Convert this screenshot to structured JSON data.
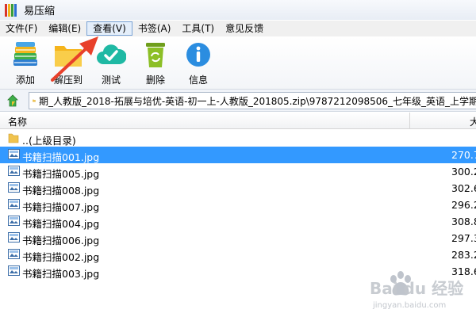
{
  "window": {
    "title": "易压缩"
  },
  "menu": {
    "items": [
      {
        "label": "文件(F)"
      },
      {
        "label": "编辑(E)"
      },
      {
        "label": "查看(V)"
      },
      {
        "label": "书签(A)"
      },
      {
        "label": "工具(T)"
      },
      {
        "label": "意见反馈"
      }
    ],
    "active_index": 2
  },
  "toolbar": {
    "add_label": "添加",
    "extract_label": "解压到",
    "test_label": "测试",
    "delete_label": "删除",
    "info_label": "信息"
  },
  "address": {
    "path": "期_人教版_2018-拓展与培优-英语-初一上-人教版_201805.zip\\9787212098506_七年级_英语_上学期_"
  },
  "list": {
    "columns": {
      "name": "名称",
      "size": "大"
    },
    "parent": {
      "name": "..(上级目录)"
    },
    "files": [
      {
        "name": "书籍扫描001.jpg",
        "size": "270.7",
        "selected": true
      },
      {
        "name": "书籍扫描005.jpg",
        "size": "300.2",
        "selected": false
      },
      {
        "name": "书籍扫描008.jpg",
        "size": "302.6",
        "selected": false
      },
      {
        "name": "书籍扫描007.jpg",
        "size": "296.2",
        "selected": false
      },
      {
        "name": "书籍扫描004.jpg",
        "size": "308.8",
        "selected": false
      },
      {
        "name": "书籍扫描006.jpg",
        "size": "297.3",
        "selected": false
      },
      {
        "name": "书籍扫描002.jpg",
        "size": "283.2",
        "selected": false
      },
      {
        "name": "书籍扫描003.jpg",
        "size": "318.6",
        "selected": false
      }
    ]
  },
  "colors": {
    "selection": "#3399ff",
    "annotation_arrow": "#e8402a",
    "folder": "#f0c34e",
    "extract": "#f5b41c",
    "test": "#1fb9a4",
    "delete": "#8cbf26",
    "info": "#2b8de0"
  },
  "watermark": {
    "text": "Bai du 经验",
    "subtext": "jingyan.baidu.com"
  }
}
